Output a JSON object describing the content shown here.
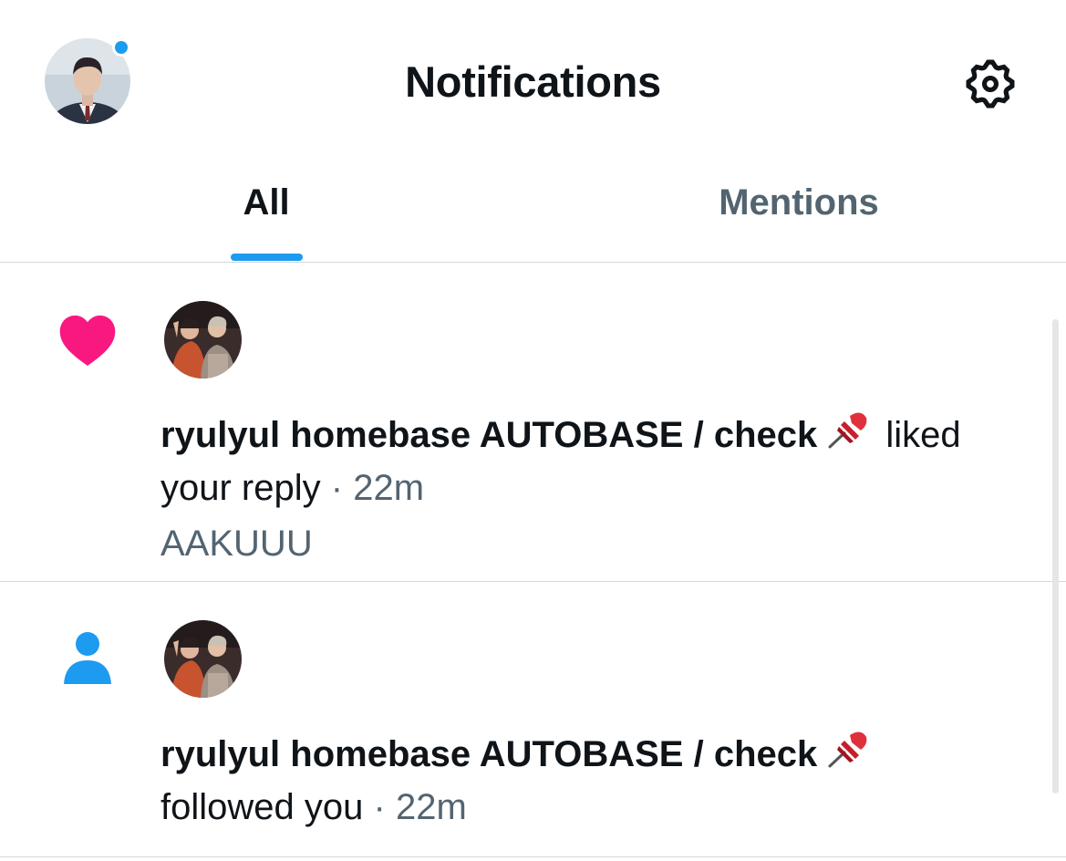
{
  "header": {
    "title": "Notifications",
    "unread_color": "#1d9bf0",
    "settings_icon": "gear-icon"
  },
  "tabs": [
    {
      "label": "All",
      "selected": true
    },
    {
      "label": "Mentions",
      "selected": false
    }
  ],
  "colors": {
    "accent": "#1d9bf0",
    "like": "#f91880",
    "secondary_text": "#536471",
    "primary_text": "#0f1419"
  },
  "notifications": [
    {
      "type_icon": "heart-icon",
      "user_name": "ryulyul homebase AUTOBASE / check",
      "name_emoji_icon": "pushpin-icon",
      "action": "liked your reply",
      "separator": "·",
      "time": "22m",
      "preview": "AAKUUU"
    },
    {
      "type_icon": "person-icon",
      "user_name": "ryulyul homebase AUTOBASE / check",
      "name_emoji_icon": "pushpin-icon",
      "action": "followed you",
      "separator": "·",
      "time": "22m"
    }
  ]
}
